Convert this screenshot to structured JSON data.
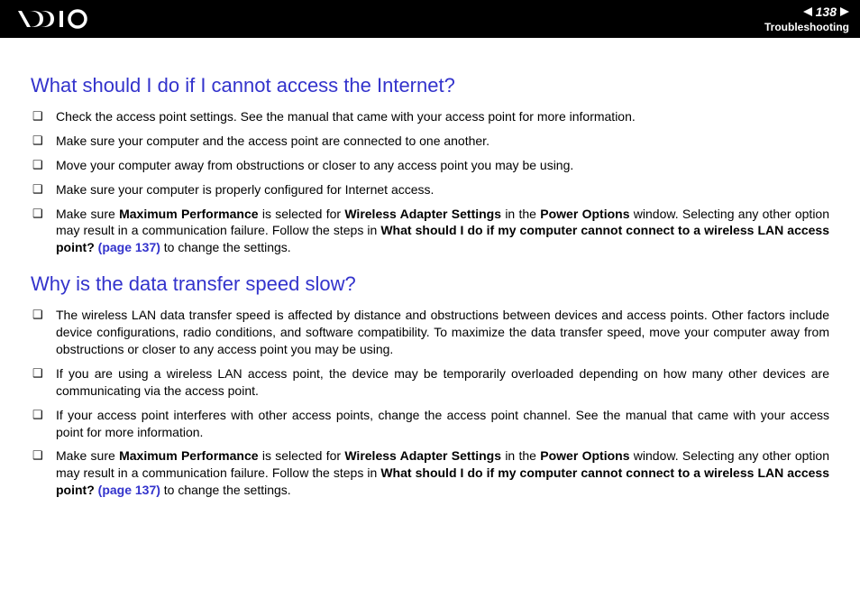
{
  "header": {
    "page_number": "138",
    "section": "Troubleshooting"
  },
  "q1": {
    "title": "What should I do if I cannot access the Internet?",
    "items": {
      "i0": "Check the access point settings. See the manual that came with your access point for more information.",
      "i1": "Make sure your computer and the access point are connected to one another.",
      "i2": "Move your computer away from obstructions or closer to any access point you may be using.",
      "i3": "Make sure your computer is properly configured for Internet access.",
      "i4_pre": "Make sure ",
      "i4_b1": "Maximum Performance",
      "i4_mid1": " is selected for ",
      "i4_b2": "Wireless Adapter Settings",
      "i4_mid2": " in the ",
      "i4_b3": "Power Options",
      "i4_mid3": " window. Selecting any other option may result in a communication failure. Follow the steps in ",
      "i4_b4": "What should I do if my computer cannot connect to a wireless LAN access point? ",
      "i4_link": "(page 137)",
      "i4_post": " to change the settings."
    }
  },
  "q2": {
    "title": "Why is the data transfer speed slow?",
    "items": {
      "i0": "The wireless LAN data transfer speed is affected by distance and obstructions between devices and access points. Other factors include device configurations, radio conditions, and software compatibility. To maximize the data transfer speed, move your computer away from obstructions or closer to any access point you may be using.",
      "i1": "If you are using a wireless LAN access point, the device may be temporarily overloaded depending on how many other devices are communicating via the access point.",
      "i2": "If your access point interferes with other access points, change the access point channel. See the manual that came with your access point for more information.",
      "i3_pre": "Make sure ",
      "i3_b1": "Maximum Performance",
      "i3_mid1": " is selected for ",
      "i3_b2": "Wireless Adapter Settings",
      "i3_mid2": " in the ",
      "i3_b3": "Power Options",
      "i3_mid3": " window. Selecting any other option may result in a communication failure. Follow the steps in ",
      "i3_b4": "What should I do if my computer cannot connect to a wireless LAN access point? ",
      "i3_link": "(page 137)",
      "i3_post": " to change the settings."
    }
  }
}
